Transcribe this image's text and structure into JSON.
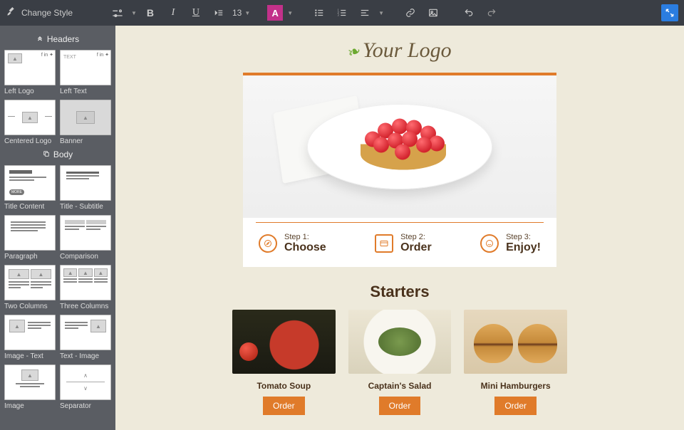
{
  "topbar": {
    "change_style": "Change Style",
    "font_size": "13",
    "color_letter": "A"
  },
  "sidebar": {
    "headers_title": "Headers",
    "body_title": "Body",
    "headers": [
      {
        "label": "Left Logo"
      },
      {
        "label": "Left Text"
      },
      {
        "label": "Centered Logo"
      },
      {
        "label": "Banner"
      }
    ],
    "body": [
      {
        "label": "Title Content"
      },
      {
        "label": "Title - Subtitle"
      },
      {
        "label": "Paragraph"
      },
      {
        "label": "Comparison"
      },
      {
        "label": "Two Columns"
      },
      {
        "label": "Three Columns"
      },
      {
        "label": "Image - Text"
      },
      {
        "label": "Text - Image"
      },
      {
        "label": "Image"
      },
      {
        "label": "Separator"
      }
    ]
  },
  "canvas": {
    "logo_text": "Your Logo",
    "steps": [
      {
        "label": "Step 1:",
        "value": "Choose"
      },
      {
        "label": "Step 2:",
        "value": "Order"
      },
      {
        "label": "Step 3:",
        "value": "Enjoy!"
      }
    ],
    "section_title": "Starters",
    "starters": [
      {
        "name": "Tomato Soup",
        "button": "Order"
      },
      {
        "name": "Captain's Salad",
        "button": "Order"
      },
      {
        "name": "Mini Hamburgers",
        "button": "Order"
      }
    ]
  },
  "thumb_text_placeholder": "TEXT",
  "thumb_more_label": "MORE"
}
